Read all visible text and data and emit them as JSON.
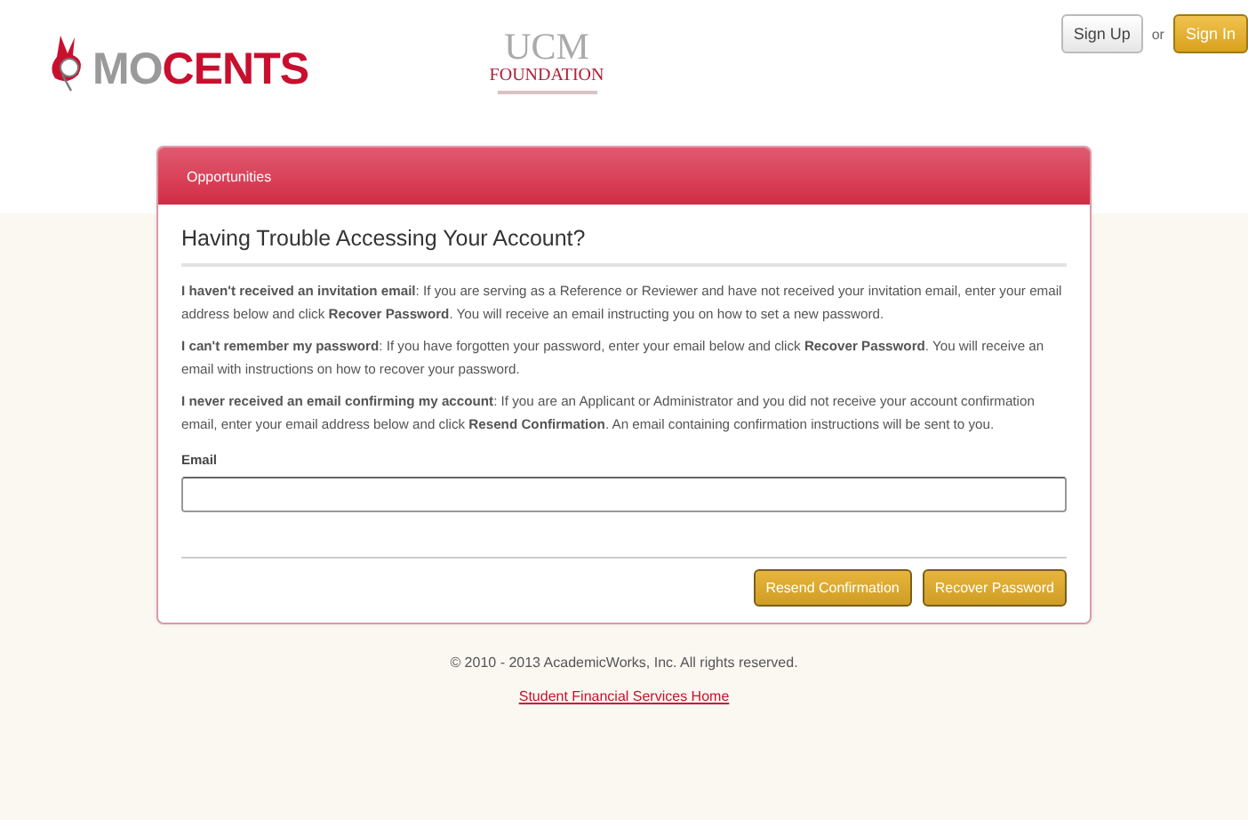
{
  "header": {
    "logo": [
      "MO",
      "CENTS"
    ],
    "partner_logo": [
      "UCM",
      "FOUNDATION"
    ],
    "buttons": [
      {
        "label": "Sign Up",
        "kind": "plain"
      },
      {
        "label": "Sign In",
        "kind": "primary"
      }
    ],
    "separator": "or"
  },
  "panel": {
    "tab": "Opportunities",
    "title": "Having Trouble Accessing Your Account?",
    "paragraphs": [
      "**I haven't received an invitation email**: If you are serving as a Reference or Reviewer and have not received your invitation email, enter your email address below and click **Recover Password**. You will receive an email instructing you on how to set a new password.",
      "**I can't remember my password**: If you have forgotten your password, enter your email below and click **Recover Password**. You will receive an email with instructions on how to recover your password.",
      "**I never received an email confirming my account**: If you are an Applicant or Administrator and you did not receive your account confirmation email, enter your email address below and click **Resend Confirmation**. An email containing confirmation instructions will be sent to you."
    ],
    "field": {
      "label": "Email"
    },
    "buttons": [
      "Resend Confirmation",
      "Recover Password"
    ]
  },
  "footer": {
    "copyright": "© 2010 - 2013 AcademicWorks, Inc. All rights reserved.",
    "link": "Student Financial Services Home"
  }
}
